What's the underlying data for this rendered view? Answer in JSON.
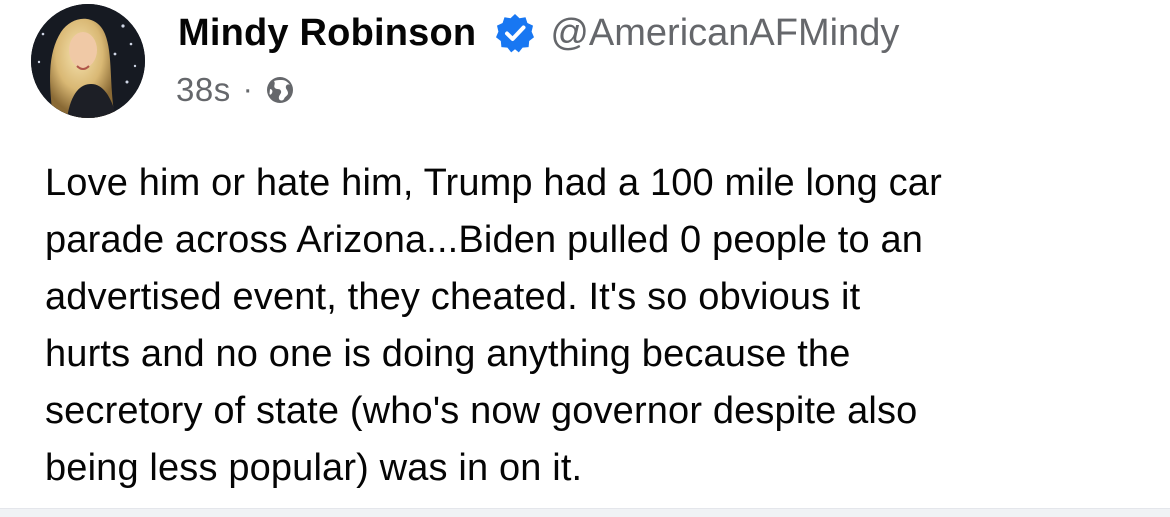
{
  "post": {
    "author_name": "Mindy Robinson",
    "author_handle": "@AmericanAFMindy",
    "verified": true,
    "timestamp": "38s",
    "separator": "·",
    "audience_icon": "globe-icon",
    "body_lines": [
      "Love him or hate him, Trump had a 100 mile long car",
      "parade across Arizona...Biden pulled 0 people to an",
      "advertised event, they cheated. It's so obvious it",
      "hurts and no one is doing anything because the",
      "secretory of state (who's now governor despite also",
      "being less popular) was in on it."
    ]
  },
  "colors": {
    "verified_badge": "#1877f2",
    "secondary_text": "#65676b",
    "primary_text": "#050505",
    "divider": "#f0f2f5"
  }
}
